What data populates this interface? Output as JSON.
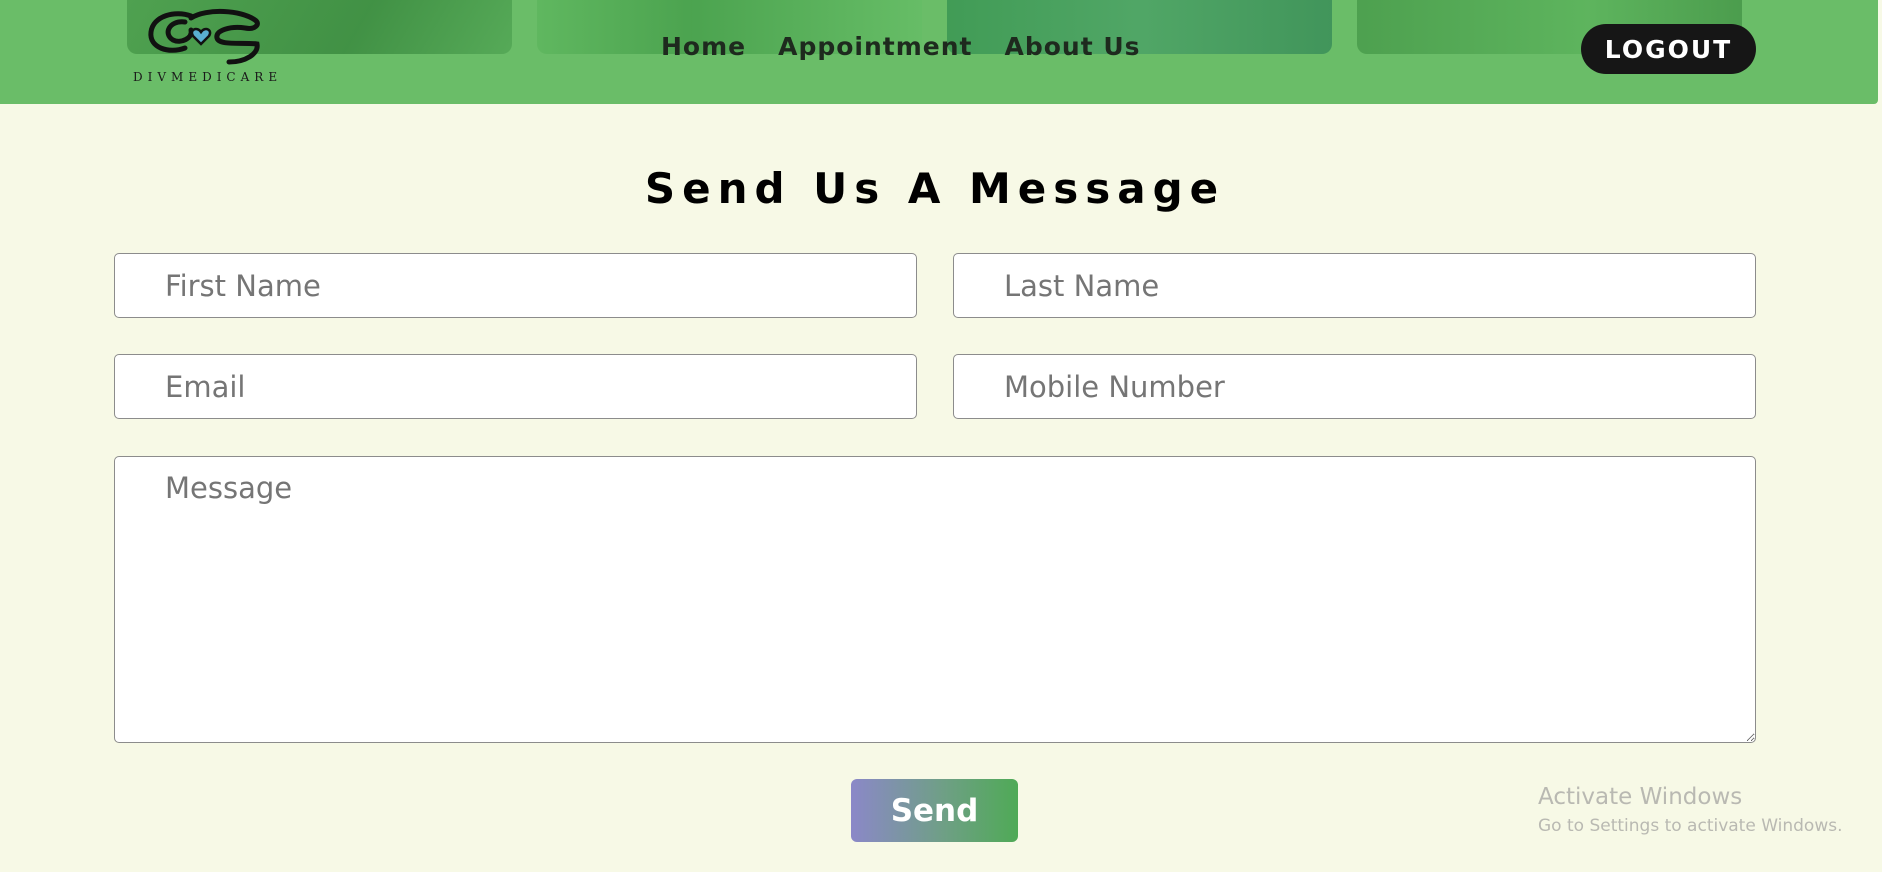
{
  "header": {
    "logo_text": "DIVMEDICARE",
    "nav": {
      "home": "Home",
      "appointment": "Appointment",
      "about": "About Us"
    },
    "logout_label": "LOGOUT"
  },
  "form": {
    "title": "Send Us A Message",
    "first_name_placeholder": "First Name",
    "last_name_placeholder": "Last Name",
    "email_placeholder": "Email",
    "mobile_placeholder": "Mobile Number",
    "message_placeholder": "Message",
    "send_label": "Send"
  },
  "watermark": {
    "title": "Activate Windows",
    "subtitle": "Go to Settings to activate Windows."
  },
  "colors": {
    "header_bg": "#6abd68",
    "page_bg": "#f7f9e6",
    "logout_bg": "#161616"
  }
}
